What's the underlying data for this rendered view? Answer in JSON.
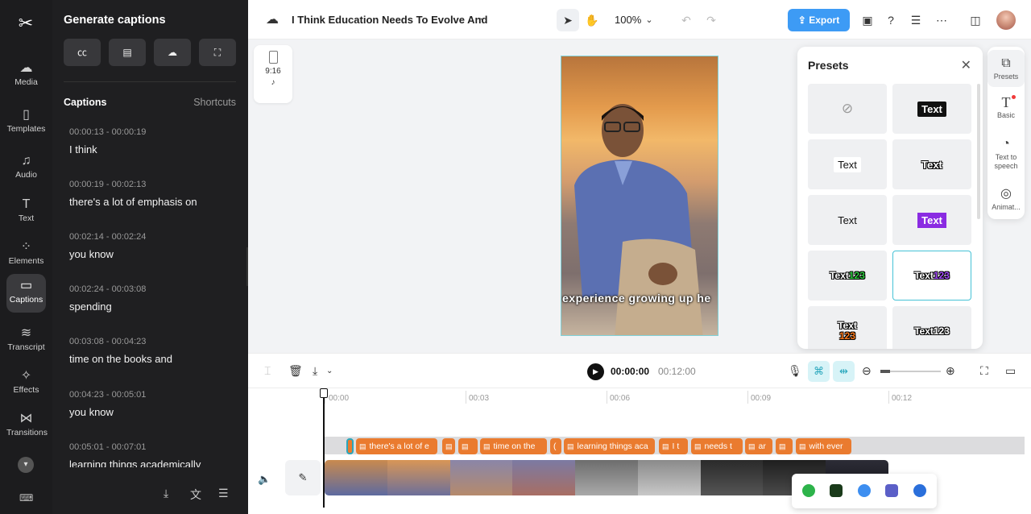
{
  "rail": {
    "items": [
      {
        "label": "Media",
        "icon": "cloud-upload-icon"
      },
      {
        "label": "Templates",
        "icon": "templates-icon"
      },
      {
        "label": "Audio",
        "icon": "music-note-icon"
      },
      {
        "label": "Text",
        "icon": "text-icon"
      },
      {
        "label": "Elements",
        "icon": "elements-icon"
      },
      {
        "label": "Captions",
        "icon": "captions-icon"
      },
      {
        "label": "Transcript",
        "icon": "transcript-icon"
      },
      {
        "label": "Effects",
        "icon": "sparkle-icon"
      },
      {
        "label": "Transitions",
        "icon": "bowtie-icon"
      }
    ]
  },
  "caption_panel": {
    "title": "Generate captions",
    "section_title": "Captions",
    "shortcuts_label": "Shortcuts",
    "items": [
      {
        "time": "00:00:13 - 00:00:19",
        "text": "I think"
      },
      {
        "time": "00:00:19 - 00:02:13",
        "text": "there's a lot of emphasis on"
      },
      {
        "time": "00:02:14 - 00:02:24",
        "text": "you know"
      },
      {
        "time": "00:02:24 - 00:03:08",
        "text": "spending"
      },
      {
        "time": "00:03:08 - 00:04:23",
        "text": "time on the books and"
      },
      {
        "time": "00:04:23 - 00:05:01",
        "text": "you know"
      },
      {
        "time": "00:05:01 - 00:07:01",
        "text": "learning things academically"
      }
    ]
  },
  "topbar": {
    "project_title": "I Think Education Needs To Evolve And",
    "zoom": "100%",
    "export_label": "Export"
  },
  "canvas": {
    "aspect_ratio": "9:16",
    "caption_text": "experience growing up he"
  },
  "presets": {
    "title": "Presets",
    "cells": [
      {
        "label": "",
        "style": "none"
      },
      {
        "label": "Text",
        "style": "white-on-black"
      },
      {
        "label": "Text",
        "style": "black-on-white"
      },
      {
        "label": "Text",
        "style": "outlined"
      },
      {
        "label": "Text",
        "style": "plain"
      },
      {
        "label": "Text",
        "style": "white-on-purple"
      },
      {
        "label": "Text",
        "accent": "123",
        "style": "green-accent"
      },
      {
        "label": "Text",
        "accent": "123",
        "style": "purple-accent"
      },
      {
        "label": "Text",
        "accent": "123",
        "style": "orange-stack"
      },
      {
        "label": "Text",
        "accent": "123",
        "style": "outlined-small"
      }
    ]
  },
  "right_tabs": [
    {
      "label": "Presets",
      "icon": "presets-icon"
    },
    {
      "label": "Basic",
      "icon": "text-t-icon"
    },
    {
      "label": "Text to speech",
      "icon": "speech-icon"
    },
    {
      "label": "Animat...",
      "icon": "animation-icon"
    }
  ],
  "timeline": {
    "current_time": "00:00:00",
    "total_time": "00:12:00",
    "ticks": [
      "00:00",
      "00:03",
      "00:06",
      "00:09",
      "00:12"
    ],
    "chips": [
      {
        "text": ""
      },
      {
        "text": "there's a lot of e"
      },
      {
        "text": ""
      },
      {
        "text": ""
      },
      {
        "text": "time on the"
      },
      {
        "text": "("
      },
      {
        "text": "learning things aca"
      },
      {
        "text": "I t"
      },
      {
        "text": "needs t"
      },
      {
        "text": "ar"
      },
      {
        "text": ""
      },
      {
        "text": "with ever"
      }
    ]
  },
  "colors": {
    "accent": "#3d9bf5",
    "caption_chip": "#ea7b2f",
    "selection": "#46c2d6"
  }
}
